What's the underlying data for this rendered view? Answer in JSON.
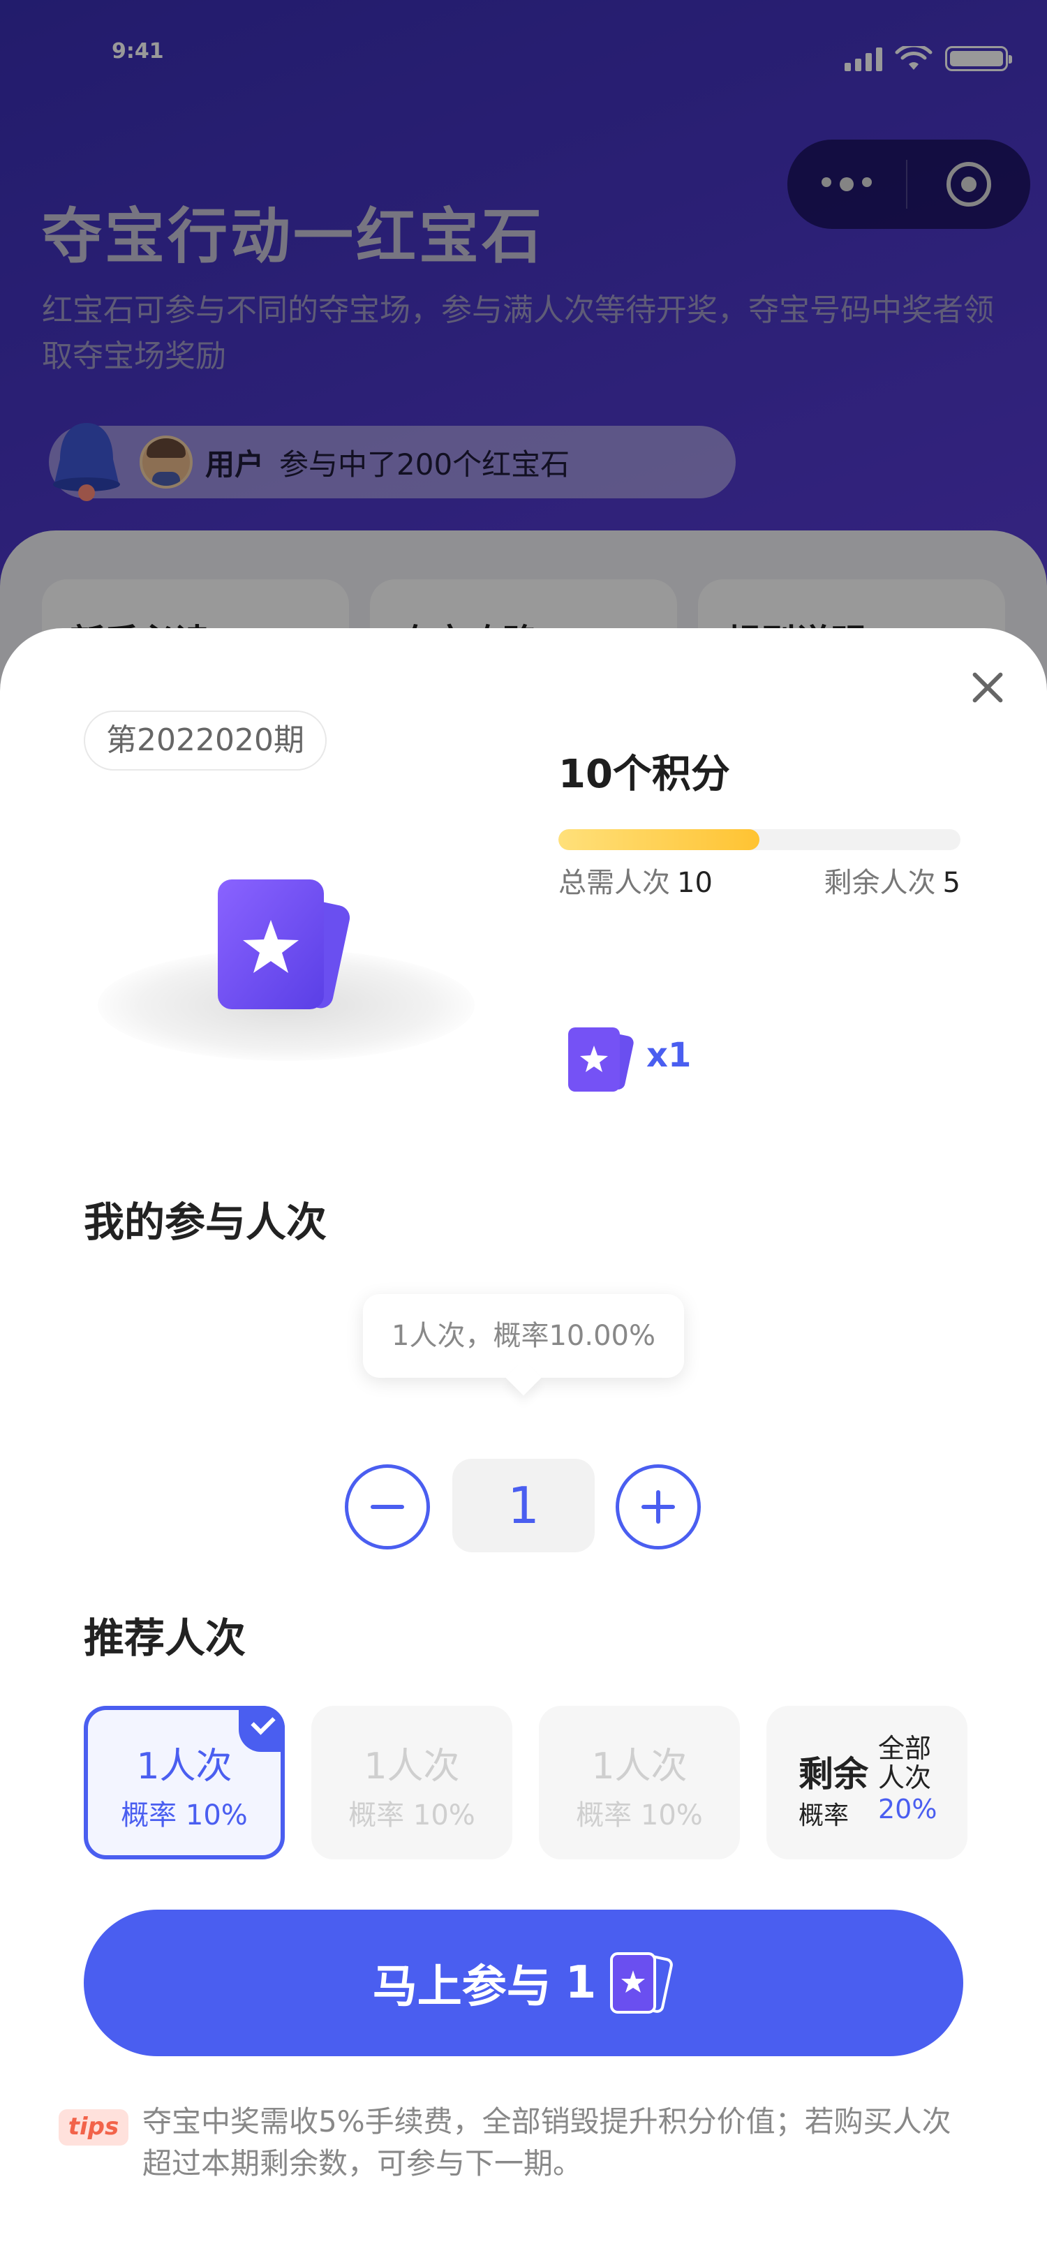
{
  "status_bar": {
    "time": "9:41"
  },
  "header": {
    "title": "夺宝行动一红宝石",
    "description": "红宝石可参与不同的夺宝场，参与满人次等待开奖，夺宝号码中奖者领取夺宝场奖励"
  },
  "notice": {
    "user": "用户",
    "message": "参与中了200个红宝石"
  },
  "bg_tabs": [
    "新手必读",
    "夺宝攻略",
    "规则说明"
  ],
  "sheet": {
    "period": "第2022020期",
    "prize_name": "10个积分",
    "progress_fraction": 0.5,
    "total_label": "总需人次",
    "total_value": "10",
    "remain_label": "剩余人次",
    "remain_value": "5",
    "multiplier": "x1",
    "join_title": "我的参与人次",
    "tooltip": "1人次，概率10.00%",
    "stepper_value": "1",
    "recommend_title": "推荐人次",
    "options": [
      {
        "count": "1人次",
        "prob": "概率 10%",
        "selected": true
      },
      {
        "count": "1人次",
        "prob": "概率 10%",
        "selected": false
      },
      {
        "count": "1人次",
        "prob": "概率 10%",
        "selected": false
      }
    ],
    "remain_option": {
      "big": "剩余",
      "sub": "概率",
      "right_top": "全部人次",
      "right_bottom": "20%"
    },
    "cta": {
      "label": "马上参与",
      "count": "1"
    },
    "tips_tag": "tips",
    "tips_text": "夺宝中奖需收5%手续费，全部销毁提升积分价值；若购买人次超过本期剩余数，可参与下一期。"
  },
  "colors": {
    "accent": "#4a5ef0",
    "progress": "#ffc332",
    "tips": "#f2634a"
  }
}
